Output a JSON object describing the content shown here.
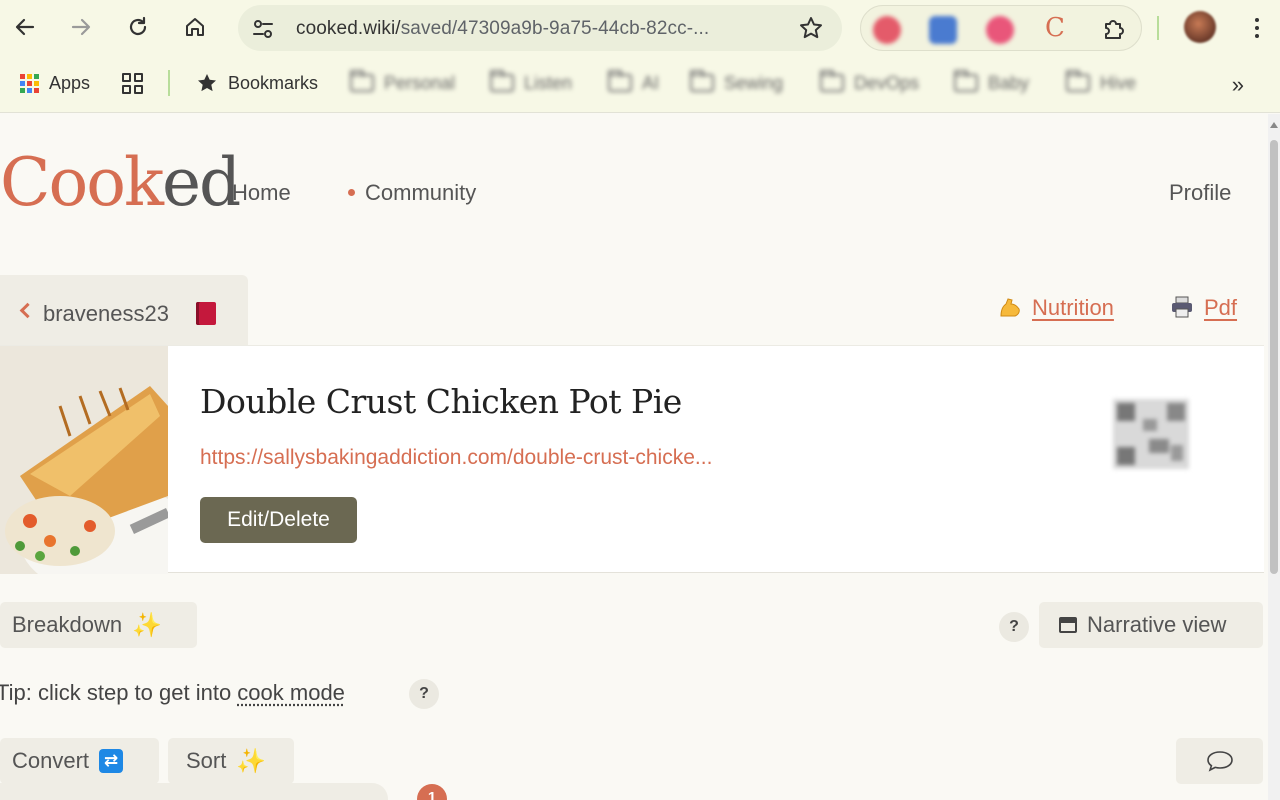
{
  "browser": {
    "url_main": "cooked.wiki/",
    "url_rest": "saved/47309a9b-9a75-44cb-82cc-...",
    "extensions": [
      "red-ext-icon",
      "translate-ext-icon",
      "pink-ext-icon",
      "cooked-ext-icon",
      "puzzle-icon"
    ],
    "extension_letter": "C",
    "bookmarks": {
      "apps_label": "Apps",
      "bookmarks_label": "Bookmarks",
      "folders": [
        "Personal",
        "Listen",
        "AI",
        "Sewing",
        "DevOps",
        "Baby",
        "Hive"
      ]
    },
    "overflow_label": "»"
  },
  "site": {
    "logo_main": "Cook",
    "logo_end": "ed",
    "nav": {
      "home": "Home",
      "community": "Community",
      "profile": "Profile"
    }
  },
  "recipe": {
    "back_user": "braveness23",
    "nutrition_label": "Nutrition",
    "pdf_label": "Pdf",
    "title": "Double Crust Chicken Pot Pie",
    "source_url": "https://sallysbakingaddiction.com/double-crust-chicke...",
    "edit_label": "Edit/Delete"
  },
  "toolbar": {
    "breakdown_label": "Breakdown",
    "help_label": "?",
    "narrative_label": "Narrative view",
    "tip_prefix": "Tip: click step to get into ",
    "tip_link": "cook mode",
    "convert_label": "Convert",
    "sort_label": "Sort",
    "badge_count": "1"
  },
  "colors": {
    "accent": "#d66e52",
    "button_dark": "#6b6852",
    "pill_bg": "#efede5",
    "page_bg": "#faf9f4",
    "chrome_bg": "#f7f8e6"
  }
}
